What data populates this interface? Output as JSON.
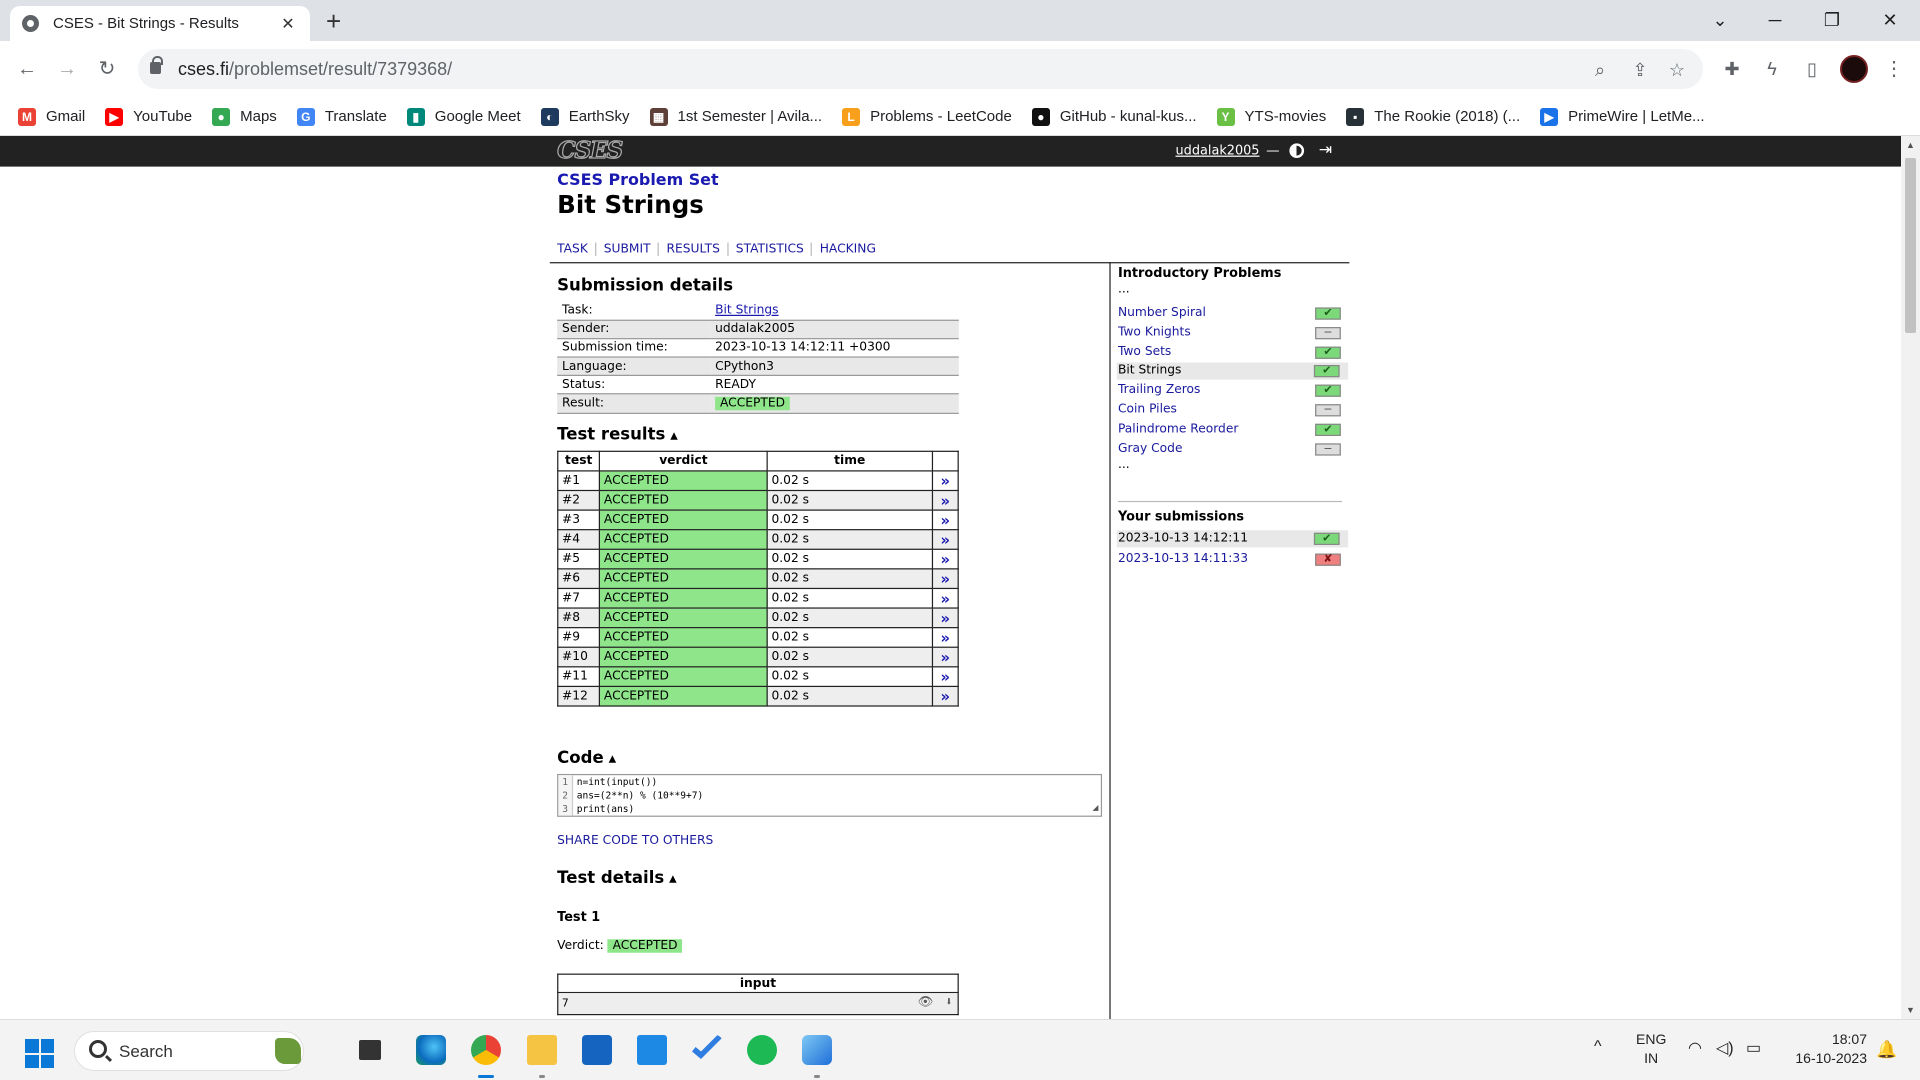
{
  "browser": {
    "tab_title": "CSES - Bit Strings - Results",
    "tab_close": "✕",
    "new_tab": "+",
    "url_host": "cses.fi",
    "url_path": "/problemset/result/7379368/",
    "bookmarks": [
      {
        "label": "Gmail",
        "icon": "gmail-icon",
        "color": "#ea4335",
        "glyph": "M"
      },
      {
        "label": "YouTube",
        "icon": "youtube-icon",
        "color": "#ff0000",
        "glyph": "▶"
      },
      {
        "label": "Maps",
        "icon": "maps-icon",
        "color": "#34a853",
        "glyph": "●"
      },
      {
        "label": "Translate",
        "icon": "translate-icon",
        "color": "#4285f4",
        "glyph": "G"
      },
      {
        "label": "Google Meet",
        "icon": "meet-icon",
        "color": "#00897b",
        "glyph": "▮"
      },
      {
        "label": "EarthSky",
        "icon": "earthsky-icon",
        "color": "#1e3a5f",
        "glyph": "◐"
      },
      {
        "label": "1st Semester | Avila...",
        "icon": "semester-icon",
        "color": "#5d4037",
        "glyph": "▦"
      },
      {
        "label": "Problems - LeetCode",
        "icon": "leetcode-icon",
        "color": "#f89f1b",
        "glyph": "L"
      },
      {
        "label": "GitHub - kunal-kus...",
        "icon": "github-icon",
        "color": "#111111",
        "glyph": "●"
      },
      {
        "label": "YTS-movies",
        "icon": "yts-icon",
        "color": "#6ac045",
        "glyph": "Y"
      },
      {
        "label": "The Rookie (2018) (...",
        "icon": "rookie-icon",
        "color": "#263238",
        "glyph": "▪"
      },
      {
        "label": "PrimeWire | LetMe...",
        "icon": "primewire-icon",
        "color": "#1a73e8",
        "glyph": "▶"
      }
    ]
  },
  "site": {
    "logo": "CSES",
    "username": "uddalak2005",
    "user_dash": "—",
    "crumb": "CSES Problem Set",
    "title": "Bit Strings",
    "nav": [
      "TASK",
      "SUBMIT",
      "RESULTS",
      "STATISTICS",
      "HACKING"
    ]
  },
  "submission": {
    "heading": "Submission details",
    "rows": [
      {
        "k": "Task:",
        "v": "Bit Strings",
        "link": true
      },
      {
        "k": "Sender:",
        "v": "uddalak2005"
      },
      {
        "k": "Submission time:",
        "v": "2023-10-13 14:12:11 +0300"
      },
      {
        "k": "Language:",
        "v": "CPython3"
      },
      {
        "k": "Status:",
        "v": "READY"
      },
      {
        "k": "Result:",
        "v": "ACCEPTED",
        "badge": true
      }
    ]
  },
  "tests": {
    "heading": "Test results",
    "caret": "▲",
    "cols": [
      "test",
      "verdict",
      "time"
    ],
    "arrow": "»",
    "rows": [
      {
        "n": "#1",
        "verdict": "ACCEPTED",
        "time": "0.02 s"
      },
      {
        "n": "#2",
        "verdict": "ACCEPTED",
        "time": "0.02 s"
      },
      {
        "n": "#3",
        "verdict": "ACCEPTED",
        "time": "0.02 s"
      },
      {
        "n": "#4",
        "verdict": "ACCEPTED",
        "time": "0.02 s"
      },
      {
        "n": "#5",
        "verdict": "ACCEPTED",
        "time": "0.02 s"
      },
      {
        "n": "#6",
        "verdict": "ACCEPTED",
        "time": "0.02 s"
      },
      {
        "n": "#7",
        "verdict": "ACCEPTED",
        "time": "0.02 s"
      },
      {
        "n": "#8",
        "verdict": "ACCEPTED",
        "time": "0.02 s"
      },
      {
        "n": "#9",
        "verdict": "ACCEPTED",
        "time": "0.02 s"
      },
      {
        "n": "#10",
        "verdict": "ACCEPTED",
        "time": "0.02 s"
      },
      {
        "n": "#11",
        "verdict": "ACCEPTED",
        "time": "0.02 s"
      },
      {
        "n": "#12",
        "verdict": "ACCEPTED",
        "time": "0.02 s"
      }
    ]
  },
  "code": {
    "heading": "Code",
    "lines": [
      "n=int(input())",
      "ans=(2**n) % (10**9+7)",
      "print(ans)"
    ],
    "share": "SHARE CODE TO OTHERS"
  },
  "test_details": {
    "heading": "Test details",
    "test_label": "Test 1",
    "verdict_label": "Verdict:",
    "verdict": "ACCEPTED",
    "input_header": "input",
    "input_value": "7"
  },
  "sidebar": {
    "heading": "Introductory Problems",
    "ellipsis": "...",
    "problems": [
      {
        "name": "Number Spiral",
        "status": "ok"
      },
      {
        "name": "Two Knights",
        "status": "none"
      },
      {
        "name": "Two Sets",
        "status": "ok"
      },
      {
        "name": "Bit Strings",
        "status": "ok",
        "current": true
      },
      {
        "name": "Trailing Zeros",
        "status": "ok"
      },
      {
        "name": "Coin Piles",
        "status": "none"
      },
      {
        "name": "Palindrome Reorder",
        "status": "ok"
      },
      {
        "name": "Gray Code",
        "status": "none"
      }
    ],
    "subs_heading": "Your submissions",
    "submissions": [
      {
        "time": "2023-10-13 14:12:11",
        "status": "ok",
        "current": true
      },
      {
        "time": "2023-10-13 14:11:33",
        "status": "bad"
      }
    ]
  },
  "taskbar": {
    "search_text": "Search",
    "lang_top": "ENG",
    "lang_bottom": "IN",
    "time": "18:07",
    "date": "16-10-2023"
  },
  "colors": {
    "accepted": "#8ee58a",
    "header": "#222222",
    "link": "#1a1ab0"
  }
}
